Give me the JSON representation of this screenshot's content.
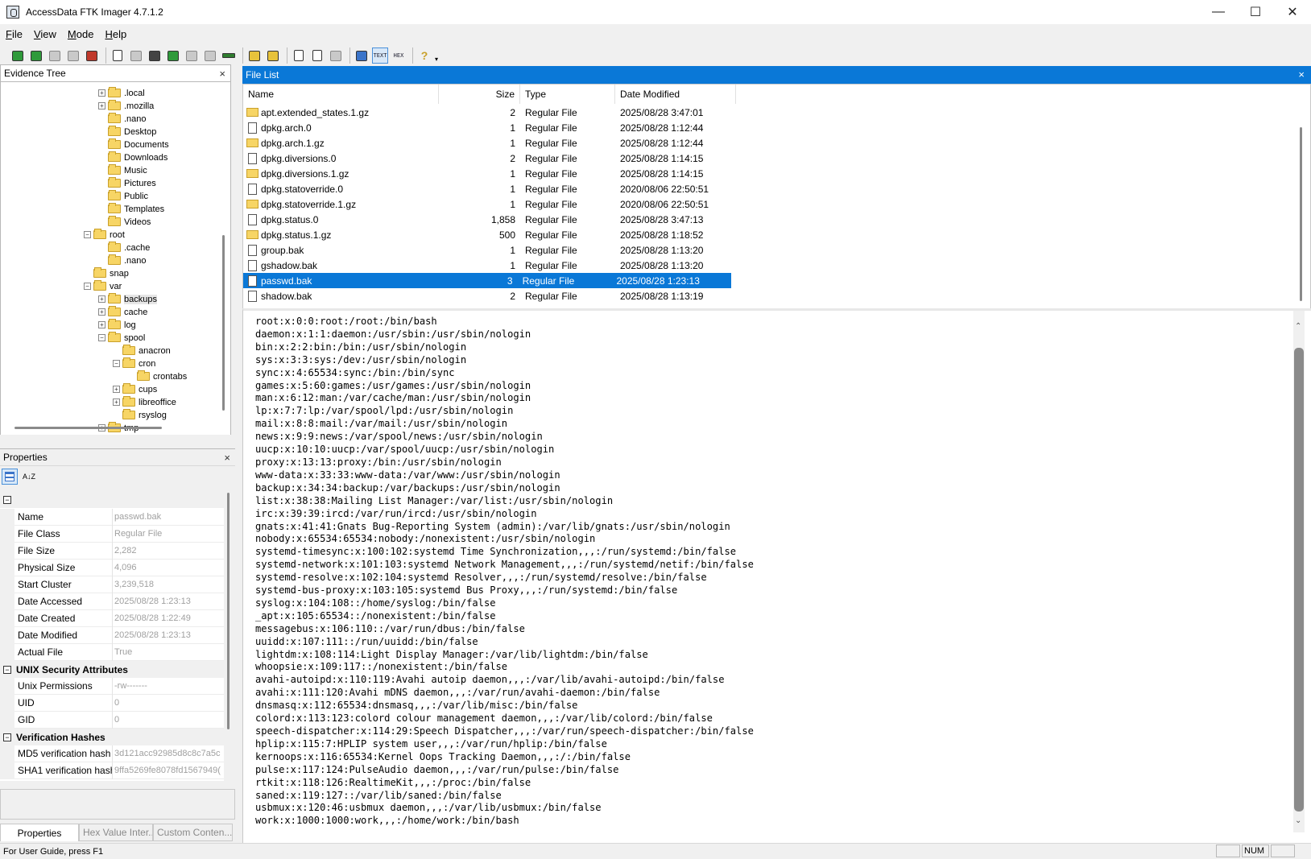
{
  "window": {
    "title": "AccessData FTK Imager 4.7.1.2",
    "controls": {
      "minimize": "—",
      "maximize": "☐",
      "close": "✕"
    }
  },
  "menu": [
    "File",
    "View",
    "Mode",
    "Help"
  ],
  "toolbar": {
    "icons": [
      "add-evidence-icon",
      "add-all-evidence-icon",
      "image-mounting-icon",
      "remove-evidence-icon",
      "remove-all-evidence-icon",
      "create-disk-image-icon",
      "export-disk-image-icon",
      "export-logical-image-icon",
      "add-to-custom-image-icon",
      "build-custom-image-icon",
      "create-hash-list-icon",
      "verify-drive-icon",
      "capture-memory-icon",
      "obtain-protected-files-icon",
      "detect-efs-icon",
      "export-files-icon",
      "export-file-hash-list-icon",
      "export-directory-listing-icon",
      "auto-viewer-icon",
      "text-viewer-icon",
      "hex-viewer-icon",
      "help-icon"
    ],
    "text_label": "TEXT",
    "hex_label": "HEX"
  },
  "evidence_tree": {
    "title": "Evidence Tree",
    "close": "×",
    "nodes": [
      {
        "label": ".local",
        "expand": "+"
      },
      {
        "label": ".mozilla",
        "expand": "+"
      },
      {
        "label": ".nano",
        "expand": ""
      },
      {
        "label": "Desktop",
        "expand": ""
      },
      {
        "label": "Documents",
        "expand": ""
      },
      {
        "label": "Downloads",
        "expand": ""
      },
      {
        "label": "Music",
        "expand": ""
      },
      {
        "label": "Pictures",
        "expand": ""
      },
      {
        "label": "Public",
        "expand": ""
      },
      {
        "label": "Templates",
        "expand": ""
      },
      {
        "label": "Videos",
        "expand": ""
      },
      {
        "label": "root",
        "expand": "−"
      },
      {
        "label": ".cache",
        "expand": ""
      },
      {
        "label": ".nano",
        "expand": ""
      },
      {
        "label": "snap",
        "expand": ""
      },
      {
        "label": "var",
        "expand": "−"
      },
      {
        "label": "backups",
        "expand": "+"
      },
      {
        "label": "cache",
        "expand": "+"
      },
      {
        "label": "log",
        "expand": "+"
      },
      {
        "label": "spool",
        "expand": "−"
      },
      {
        "label": "anacron",
        "expand": ""
      },
      {
        "label": "cron",
        "expand": "−"
      },
      {
        "label": "crontabs",
        "expand": ""
      },
      {
        "label": "cups",
        "expand": "+"
      },
      {
        "label": "libreoffice",
        "expand": "+"
      },
      {
        "label": "rsyslog",
        "expand": ""
      },
      {
        "label": "tmp",
        "expand": "+"
      }
    ]
  },
  "properties": {
    "title": "Properties",
    "close": "×",
    "sort_label": "A↓Z",
    "general_toggle": "−",
    "rows": [
      {
        "name": "Name",
        "value": "passwd.bak"
      },
      {
        "name": "File Class",
        "value": "Regular File"
      },
      {
        "name": "File Size",
        "value": "2,282"
      },
      {
        "name": "Physical Size",
        "value": "4,096"
      },
      {
        "name": "Start Cluster",
        "value": "3,239,518"
      },
      {
        "name": "Date Accessed",
        "value": "2025/08/28 1:23:13"
      },
      {
        "name": "Date Created",
        "value": "2025/08/28 1:22:49"
      },
      {
        "name": "Date Modified",
        "value": "2025/08/28 1:23:13"
      },
      {
        "name": "Actual File",
        "value": "True"
      }
    ],
    "unix_category": "UNIX Security Attributes",
    "unix_rows": [
      {
        "name": "Unix Permissions",
        "value": "-rw-------"
      },
      {
        "name": "UID",
        "value": "0"
      },
      {
        "name": "GID",
        "value": "0"
      }
    ],
    "hash_category": "Verification Hashes",
    "hash_rows": [
      {
        "name": "MD5 verification hash",
        "value": "3d121acc92985d8c8c7a5c"
      },
      {
        "name": "SHA1 verification hash",
        "value": "9ffa5269fe8078fd1567949("
      }
    ]
  },
  "tabs": [
    "Properties",
    "Hex Value Inter...",
    "Custom Conten..."
  ],
  "status": {
    "text": "For User Guide, press F1",
    "num": "NUM"
  },
  "file_list": {
    "title": "File List",
    "close": "×",
    "columns": [
      "Name",
      "Size",
      "Type",
      "Date Modified"
    ],
    "rows": [
      {
        "name": "apt.extended_states.1.gz",
        "size": "2",
        "type": "Regular File",
        "date": "2025/08/28 3:47:01",
        "gz": true
      },
      {
        "name": "dpkg.arch.0",
        "size": "1",
        "type": "Regular File",
        "date": "2025/08/28 1:12:44",
        "gz": false
      },
      {
        "name": "dpkg.arch.1.gz",
        "size": "1",
        "type": "Regular File",
        "date": "2025/08/28 1:12:44",
        "gz": true
      },
      {
        "name": "dpkg.diversions.0",
        "size": "2",
        "type": "Regular File",
        "date": "2025/08/28 1:14:15",
        "gz": false
      },
      {
        "name": "dpkg.diversions.1.gz",
        "size": "1",
        "type": "Regular File",
        "date": "2025/08/28 1:14:15",
        "gz": true
      },
      {
        "name": "dpkg.statoverride.0",
        "size": "1",
        "type": "Regular File",
        "date": "2020/08/06 22:50:51",
        "gz": false
      },
      {
        "name": "dpkg.statoverride.1.gz",
        "size": "1",
        "type": "Regular File",
        "date": "2020/08/06 22:50:51",
        "gz": true
      },
      {
        "name": "dpkg.status.0",
        "size": "1,858",
        "type": "Regular File",
        "date": "2025/08/28 3:47:13",
        "gz": false
      },
      {
        "name": "dpkg.status.1.gz",
        "size": "500",
        "type": "Regular File",
        "date": "2025/08/28 1:18:52",
        "gz": true
      },
      {
        "name": "group.bak",
        "size": "1",
        "type": "Regular File",
        "date": "2025/08/28 1:13:20",
        "gz": false
      },
      {
        "name": "gshadow.bak",
        "size": "1",
        "type": "Regular File",
        "date": "2025/08/28 1:13:20",
        "gz": false
      },
      {
        "name": "passwd.bak",
        "size": "3",
        "type": "Regular File",
        "date": "2025/08/28 1:23:13",
        "gz": false,
        "selected": true
      },
      {
        "name": "shadow.bak",
        "size": "2",
        "type": "Regular File",
        "date": "2025/08/28 1:13:19",
        "gz": false
      }
    ]
  },
  "viewer": {
    "lines": [
      "root:x:0:0:root:/root:/bin/bash",
      "daemon:x:1:1:daemon:/usr/sbin:/usr/sbin/nologin",
      "bin:x:2:2:bin:/bin:/usr/sbin/nologin",
      "sys:x:3:3:sys:/dev:/usr/sbin/nologin",
      "sync:x:4:65534:sync:/bin:/bin/sync",
      "games:x:5:60:games:/usr/games:/usr/sbin/nologin",
      "man:x:6:12:man:/var/cache/man:/usr/sbin/nologin",
      "lp:x:7:7:lp:/var/spool/lpd:/usr/sbin/nologin",
      "mail:x:8:8:mail:/var/mail:/usr/sbin/nologin",
      "news:x:9:9:news:/var/spool/news:/usr/sbin/nologin",
      "uucp:x:10:10:uucp:/var/spool/uucp:/usr/sbin/nologin",
      "proxy:x:13:13:proxy:/bin:/usr/sbin/nologin",
      "www-data:x:33:33:www-data:/var/www:/usr/sbin/nologin",
      "backup:x:34:34:backup:/var/backups:/usr/sbin/nologin",
      "list:x:38:38:Mailing List Manager:/var/list:/usr/sbin/nologin",
      "irc:x:39:39:ircd:/var/run/ircd:/usr/sbin/nologin",
      "gnats:x:41:41:Gnats Bug-Reporting System (admin):/var/lib/gnats:/usr/sbin/nologin",
      "nobody:x:65534:65534:nobody:/nonexistent:/usr/sbin/nologin",
      "systemd-timesync:x:100:102:systemd Time Synchronization,,,:/run/systemd:/bin/false",
      "systemd-network:x:101:103:systemd Network Management,,,:/run/systemd/netif:/bin/false",
      "systemd-resolve:x:102:104:systemd Resolver,,,:/run/systemd/resolve:/bin/false",
      "systemd-bus-proxy:x:103:105:systemd Bus Proxy,,,:/run/systemd:/bin/false",
      "syslog:x:104:108::/home/syslog:/bin/false",
      "_apt:x:105:65534::/nonexistent:/bin/false",
      "messagebus:x:106:110::/var/run/dbus:/bin/false",
      "uuidd:x:107:111::/run/uuidd:/bin/false",
      "lightdm:x:108:114:Light Display Manager:/var/lib/lightdm:/bin/false",
      "whoopsie:x:109:117::/nonexistent:/bin/false",
      "avahi-autoipd:x:110:119:Avahi autoip daemon,,,:/var/lib/avahi-autoipd:/bin/false",
      "avahi:x:111:120:Avahi mDNS daemon,,,:/var/run/avahi-daemon:/bin/false",
      "dnsmasq:x:112:65534:dnsmasq,,,:/var/lib/misc:/bin/false",
      "colord:x:113:123:colord colour management daemon,,,:/var/lib/colord:/bin/false",
      "speech-dispatcher:x:114:29:Speech Dispatcher,,,:/var/run/speech-dispatcher:/bin/false",
      "hplip:x:115:7:HPLIP system user,,,:/var/run/hplip:/bin/false",
      "kernoops:x:116:65534:Kernel Oops Tracking Daemon,,,:/:/bin/false",
      "pulse:x:117:124:PulseAudio daemon,,,:/var/run/pulse:/bin/false",
      "rtkit:x:118:126:RealtimeKit,,,:/proc:/bin/false",
      "saned:x:119:127::/var/lib/saned:/bin/false",
      "usbmux:x:120:46:usbmux daemon,,,:/var/lib/usbmux:/bin/false",
      "work:x:1000:1000:work,,,:/home/work:/bin/bash"
    ]
  },
  "colors": {
    "accent": "#0a78d7",
    "folder": "#f7d565"
  }
}
